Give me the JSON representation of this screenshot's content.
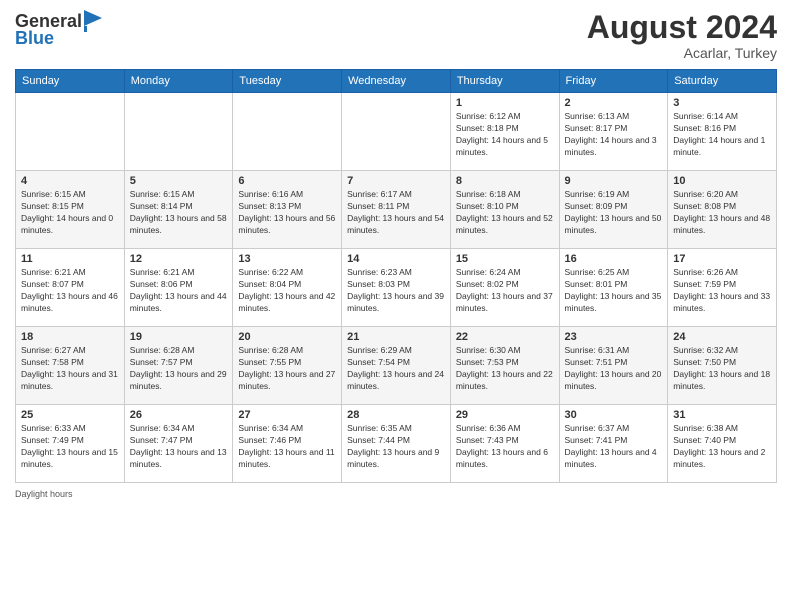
{
  "logo": {
    "general": "General",
    "blue": "Blue"
  },
  "header": {
    "month_year": "August 2024",
    "location": "Acarlar, Turkey"
  },
  "days_of_week": [
    "Sunday",
    "Monday",
    "Tuesday",
    "Wednesday",
    "Thursday",
    "Friday",
    "Saturday"
  ],
  "weeks": [
    [
      {
        "day": "",
        "info": ""
      },
      {
        "day": "",
        "info": ""
      },
      {
        "day": "",
        "info": ""
      },
      {
        "day": "",
        "info": ""
      },
      {
        "day": "1",
        "sunrise": "6:12 AM",
        "sunset": "8:18 PM",
        "daylight": "14 hours and 5 minutes."
      },
      {
        "day": "2",
        "sunrise": "6:13 AM",
        "sunset": "8:17 PM",
        "daylight": "14 hours and 3 minutes."
      },
      {
        "day": "3",
        "sunrise": "6:14 AM",
        "sunset": "8:16 PM",
        "daylight": "14 hours and 1 minute."
      }
    ],
    [
      {
        "day": "4",
        "sunrise": "6:15 AM",
        "sunset": "8:15 PM",
        "daylight": "14 hours and 0 minutes."
      },
      {
        "day": "5",
        "sunrise": "6:15 AM",
        "sunset": "8:14 PM",
        "daylight": "13 hours and 58 minutes."
      },
      {
        "day": "6",
        "sunrise": "6:16 AM",
        "sunset": "8:13 PM",
        "daylight": "13 hours and 56 minutes."
      },
      {
        "day": "7",
        "sunrise": "6:17 AM",
        "sunset": "8:11 PM",
        "daylight": "13 hours and 54 minutes."
      },
      {
        "day": "8",
        "sunrise": "6:18 AM",
        "sunset": "8:10 PM",
        "daylight": "13 hours and 52 minutes."
      },
      {
        "day": "9",
        "sunrise": "6:19 AM",
        "sunset": "8:09 PM",
        "daylight": "13 hours and 50 minutes."
      },
      {
        "day": "10",
        "sunrise": "6:20 AM",
        "sunset": "8:08 PM",
        "daylight": "13 hours and 48 minutes."
      }
    ],
    [
      {
        "day": "11",
        "sunrise": "6:21 AM",
        "sunset": "8:07 PM",
        "daylight": "13 hours and 46 minutes."
      },
      {
        "day": "12",
        "sunrise": "6:21 AM",
        "sunset": "8:06 PM",
        "daylight": "13 hours and 44 minutes."
      },
      {
        "day": "13",
        "sunrise": "6:22 AM",
        "sunset": "8:04 PM",
        "daylight": "13 hours and 42 minutes."
      },
      {
        "day": "14",
        "sunrise": "6:23 AM",
        "sunset": "8:03 PM",
        "daylight": "13 hours and 39 minutes."
      },
      {
        "day": "15",
        "sunrise": "6:24 AM",
        "sunset": "8:02 PM",
        "daylight": "13 hours and 37 minutes."
      },
      {
        "day": "16",
        "sunrise": "6:25 AM",
        "sunset": "8:01 PM",
        "daylight": "13 hours and 35 minutes."
      },
      {
        "day": "17",
        "sunrise": "6:26 AM",
        "sunset": "7:59 PM",
        "daylight": "13 hours and 33 minutes."
      }
    ],
    [
      {
        "day": "18",
        "sunrise": "6:27 AM",
        "sunset": "7:58 PM",
        "daylight": "13 hours and 31 minutes."
      },
      {
        "day": "19",
        "sunrise": "6:28 AM",
        "sunset": "7:57 PM",
        "daylight": "13 hours and 29 minutes."
      },
      {
        "day": "20",
        "sunrise": "6:28 AM",
        "sunset": "7:55 PM",
        "daylight": "13 hours and 27 minutes."
      },
      {
        "day": "21",
        "sunrise": "6:29 AM",
        "sunset": "7:54 PM",
        "daylight": "13 hours and 24 minutes."
      },
      {
        "day": "22",
        "sunrise": "6:30 AM",
        "sunset": "7:53 PM",
        "daylight": "13 hours and 22 minutes."
      },
      {
        "day": "23",
        "sunrise": "6:31 AM",
        "sunset": "7:51 PM",
        "daylight": "13 hours and 20 minutes."
      },
      {
        "day": "24",
        "sunrise": "6:32 AM",
        "sunset": "7:50 PM",
        "daylight": "13 hours and 18 minutes."
      }
    ],
    [
      {
        "day": "25",
        "sunrise": "6:33 AM",
        "sunset": "7:49 PM",
        "daylight": "13 hours and 15 minutes."
      },
      {
        "day": "26",
        "sunrise": "6:34 AM",
        "sunset": "7:47 PM",
        "daylight": "13 hours and 13 minutes."
      },
      {
        "day": "27",
        "sunrise": "6:34 AM",
        "sunset": "7:46 PM",
        "daylight": "13 hours and 11 minutes."
      },
      {
        "day": "28",
        "sunrise": "6:35 AM",
        "sunset": "7:44 PM",
        "daylight": "13 hours and 9 minutes."
      },
      {
        "day": "29",
        "sunrise": "6:36 AM",
        "sunset": "7:43 PM",
        "daylight": "13 hours and 6 minutes."
      },
      {
        "day": "30",
        "sunrise": "6:37 AM",
        "sunset": "7:41 PM",
        "daylight": "13 hours and 4 minutes."
      },
      {
        "day": "31",
        "sunrise": "6:38 AM",
        "sunset": "7:40 PM",
        "daylight": "13 hours and 2 minutes."
      }
    ]
  ],
  "footer": {
    "daylight_label": "Daylight hours"
  }
}
